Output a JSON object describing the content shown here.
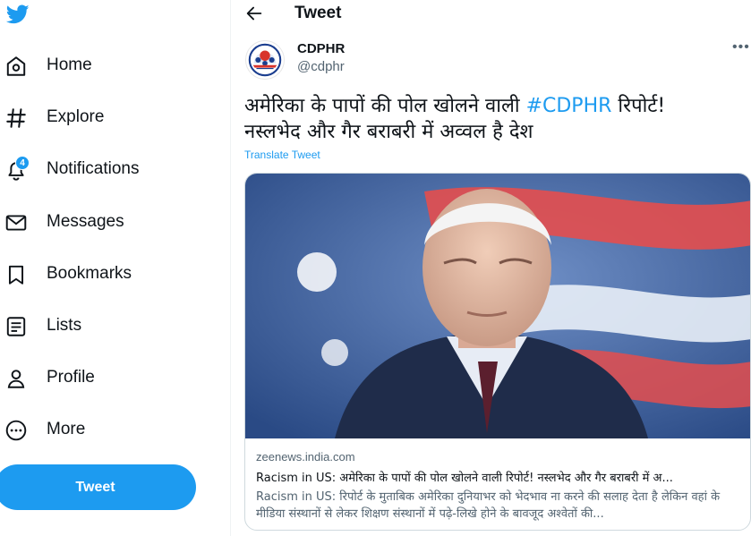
{
  "sidebar": {
    "items": [
      {
        "label": "Home",
        "icon": "home-icon"
      },
      {
        "label": "Explore",
        "icon": "hashtag-icon"
      },
      {
        "label": "Notifications",
        "icon": "bell-icon",
        "badge": "4"
      },
      {
        "label": "Messages",
        "icon": "envelope-icon"
      },
      {
        "label": "Bookmarks",
        "icon": "bookmark-icon"
      },
      {
        "label": "Lists",
        "icon": "list-icon"
      },
      {
        "label": "Profile",
        "icon": "person-icon"
      },
      {
        "label": "More",
        "icon": "more-circle-icon"
      }
    ],
    "tweet_button": "Tweet"
  },
  "header": {
    "title": "Tweet"
  },
  "tweet": {
    "author_name": "CDPHR",
    "author_handle": "@cdphr",
    "text_before": "अमेरिका के पापों की पोल खोलने वाली ",
    "hashtag": "#CDPHR",
    "text_after": " रिपोर्ट! नस्लभेद और गैर बराबरी में अव्वल है देश",
    "translate_label": "Translate Tweet"
  },
  "card": {
    "domain": "zeenews.india.com",
    "title": "Racism in US: अमेरिका के पापों की पोल खोलने वाली रिपोर्ट! नस्लभेद और गैर बराबरी में अ...",
    "description": "Racism in US: रिपोर्ट के मुताबिक अमेरिका दुनियाभर को भेदभाव ना करने की सलाह देता है लेकिन वहां के मीडिया संस्थानों से लेकर शिक्षण संस्थानों में पढ़े-लिखे होने के बावजूद अश्वेतों की..."
  },
  "colors": {
    "accent": "#1d9bf0",
    "text": "#0f1419",
    "muted": "#536471",
    "border": "#cfd9de"
  }
}
